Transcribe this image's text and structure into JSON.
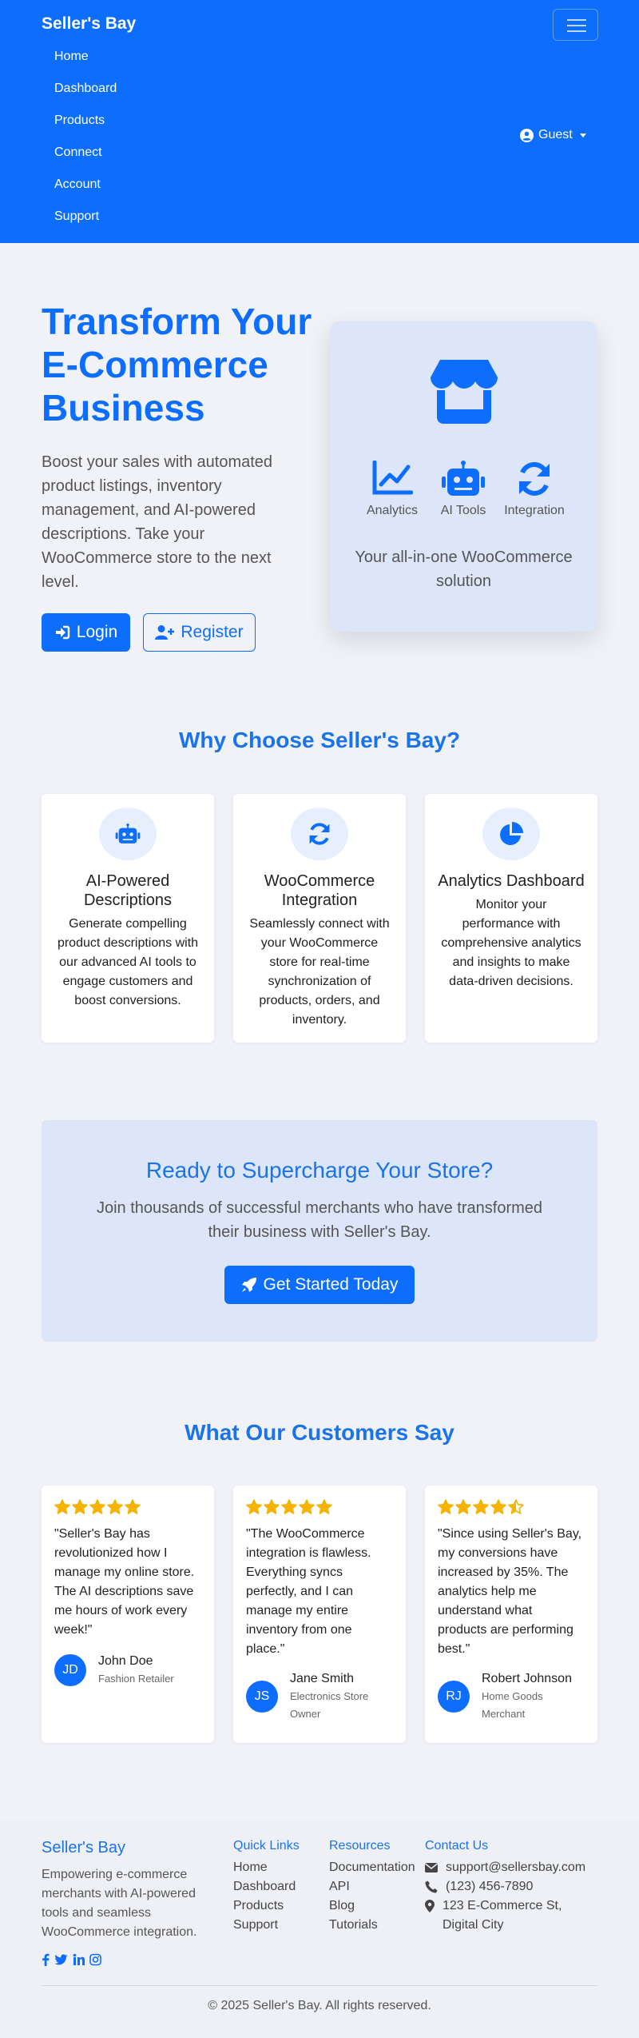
{
  "brand": "Seller's Bay",
  "nav": {
    "items": [
      "Home",
      "Dashboard",
      "Products",
      "Connect",
      "Account",
      "Support"
    ],
    "user_label": "Guest"
  },
  "hero": {
    "title": "Transform Your E-Commerce Business",
    "text": "Boost your sales with automated product listings, inventory management, and AI-powered descriptions. Take your WooCommerce store to the next level.",
    "login_label": "Login",
    "register_label": "Register",
    "features": [
      "Analytics",
      "AI Tools",
      "Integration"
    ],
    "card_text": "Your all-in-one WooCommerce solution"
  },
  "why": {
    "title": "Why Choose Seller's Bay?",
    "cards": [
      {
        "title": "AI-Powered Descriptions",
        "text": "Generate compelling product descriptions with our advanced AI tools to engage customers and boost conversions.",
        "icon": "robot-icon"
      },
      {
        "title": "WooCommerce Integration",
        "text": "Seamlessly connect with your WooCommerce store for real-time synchronization of products, orders, and inventory.",
        "icon": "sync-icon"
      },
      {
        "title": "Analytics Dashboard",
        "text": "Monitor your performance with comprehensive analytics and insights to make data-driven decisions.",
        "icon": "pie-chart-icon"
      }
    ]
  },
  "cta": {
    "title": "Ready to Supercharge Your Store?",
    "text": "Join thousands of successful merchants who have transformed their business with Seller's Bay.",
    "button": "Get Started Today"
  },
  "testimonials": {
    "title": "What Our Customers Say",
    "items": [
      {
        "rating": 5,
        "quote": "\"Seller's Bay has revolutionized how I manage my online store. The AI descriptions save me hours of work every week!\"",
        "initials": "JD",
        "name": "John Doe",
        "role": "Fashion Retailer"
      },
      {
        "rating": 5,
        "quote": "\"The WooCommerce integration is flawless. Everything syncs perfectly, and I can manage my entire inventory from one place.\"",
        "initials": "JS",
        "name": "Jane Smith",
        "role": "Electronics Store Owner"
      },
      {
        "rating": 4.5,
        "quote": "\"Since using Seller's Bay, my conversions have increased by 35%. The analytics help me understand what products are performing best.\"",
        "initials": "RJ",
        "name": "Robert Johnson",
        "role": "Home Goods Merchant"
      }
    ]
  },
  "footer": {
    "brand": "Seller's Bay",
    "description": "Empowering e-commerce merchants with AI-powered tools and seamless WooCommerce integration.",
    "quick_links": {
      "title": "Quick Links",
      "items": [
        "Home",
        "Dashboard",
        "Products",
        "Support"
      ]
    },
    "resources": {
      "title": "Resources",
      "items": [
        "Documentation",
        "API",
        "Blog",
        "Tutorials"
      ]
    },
    "contact": {
      "title": "Contact Us",
      "email": "support@sellersbay.com",
      "phone": "(123) 456-7890",
      "address": "123 E-Commerce St, Digital City"
    },
    "copyright": "© 2025 Seller's Bay. All rights reserved."
  },
  "colors": {
    "primary": "#0d6efd",
    "heading": "#1a73e8",
    "star": "#f5b400",
    "light_panel": "#dce6f8"
  }
}
